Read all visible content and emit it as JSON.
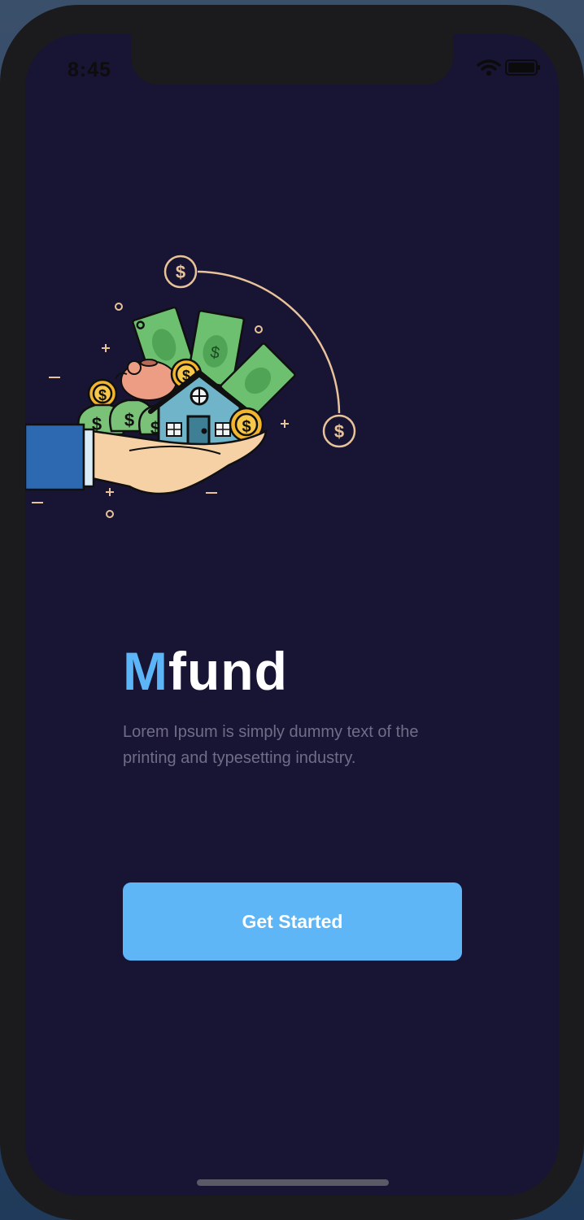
{
  "status_bar": {
    "time": "8:45"
  },
  "brand": {
    "accent": "M",
    "rest": "fund",
    "accent_color": "#5bb5f7"
  },
  "tagline": "Lorem Ipsum is simply dummy text of the printing and typesetting industry.",
  "cta": {
    "label": "Get Started",
    "color": "#5fb6f7"
  },
  "illustration": {
    "currency_symbol": "$"
  },
  "colors": {
    "background": "#181433",
    "bezel": "#1b1b1d"
  }
}
